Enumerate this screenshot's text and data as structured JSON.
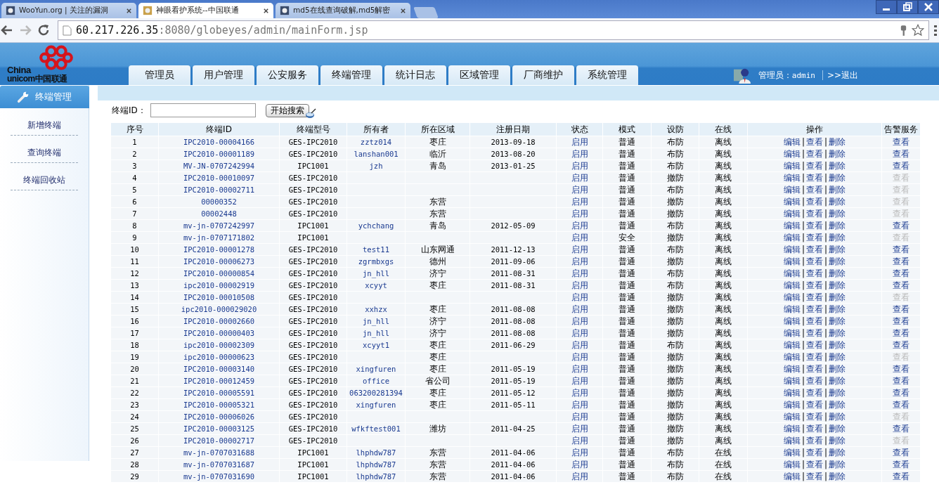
{
  "browser": {
    "tabs": [
      {
        "title": "WooYun.org | 关注的漏洞",
        "selected": false
      },
      {
        "title": "神眼看护系统--中国联通",
        "selected": true
      },
      {
        "title": "md5在线查询破解,md5解密",
        "selected": false
      }
    ],
    "url": {
      "host": "60.217.226.35",
      "path": ":8080/globeyes/admin/mainForm.jsp"
    }
  },
  "header": {
    "logo_text": [
      "China",
      "unicom中国联通"
    ],
    "nav": [
      "管理员",
      "用户管理",
      "公安服务",
      "终端管理",
      "统计日志",
      "区域管理",
      "厂商维护",
      "系统管理"
    ],
    "user_label": "管理员：",
    "user_name": "admin",
    "logout": ">>退出"
  },
  "sidebar": {
    "title": "终端管理",
    "items": [
      "新增终端",
      "查询终端",
      "终端回收站"
    ]
  },
  "search": {
    "label": "终端ID：",
    "button": "开始搜索"
  },
  "table": {
    "columns": [
      "序号",
      "终端ID",
      "终端型号",
      "所有者",
      "所在区域",
      "注册日期",
      "状态",
      "模式",
      "设防",
      "在线",
      "操作",
      "告警服务"
    ],
    "rows": [
      {
        "n": "1",
        "id": "IPC2010-00004166",
        "model": "GES-IPC2010",
        "owner": "zztz014",
        "region": "枣庄",
        "date": "2013-09-18",
        "status": "启用",
        "mode": "普通",
        "defense": "布防",
        "online": "离线",
        "actions": [
          "编辑",
          "|",
          "查看",
          "|",
          "删除"
        ],
        "alarm": "查看",
        "alarm_enabled": true
      },
      {
        "n": "2",
        "id": "IPC2010-00001189",
        "model": "GES-IPC2010",
        "owner": "lanshan001",
        "region": "临沂",
        "date": "2013-08-20",
        "status": "启用",
        "mode": "普通",
        "defense": "布防",
        "online": "离线",
        "actions": [
          "编辑",
          "|",
          "查看",
          "|",
          "删除"
        ],
        "alarm": "查看",
        "alarm_enabled": true
      },
      {
        "n": "3",
        "id": "MV-JN-0707242994",
        "model": "IPC1001",
        "owner": "jzh",
        "region": "青岛",
        "date": "2013-01-25",
        "status": "启用",
        "mode": "普通",
        "defense": "布防",
        "online": "离线",
        "actions": [
          "编辑",
          "|",
          "查看",
          "|",
          "删除"
        ],
        "alarm": "查看",
        "alarm_enabled": true
      },
      {
        "n": "4",
        "id": "IPC2010-00010097",
        "model": "GES-IPC2010",
        "status": "启用",
        "mode": "普通",
        "defense": "撤防",
        "online": "离线",
        "actions": [
          "编辑",
          "|",
          "查看",
          "|",
          "删除"
        ],
        "alarm": "查看",
        "alarm_enabled": false
      },
      {
        "n": "5",
        "id": "IPC2010-00002711",
        "model": "GES-IPC2010",
        "status": "启用",
        "mode": "普通",
        "defense": "布防",
        "online": "离线",
        "actions": [
          "编辑",
          "|",
          "查看",
          "|",
          "删除"
        ],
        "alarm": "查看",
        "alarm_enabled": false
      },
      {
        "n": "6",
        "id": "00000352",
        "model": "GES-IPC2010",
        "region": "东营",
        "status": "启用",
        "mode": "普通",
        "defense": "撤防",
        "online": "离线",
        "actions": [
          "编辑",
          "|",
          "查看",
          "|",
          "删除"
        ],
        "alarm": "查看",
        "alarm_enabled": false
      },
      {
        "n": "7",
        "id": "00002448",
        "model": "GES-IPC2010",
        "region": "东营",
        "status": "启用",
        "mode": "普通",
        "defense": "撤防",
        "online": "离线",
        "actions": [
          "编辑",
          "|",
          "查看",
          "|",
          "删除"
        ],
        "alarm": "查看",
        "alarm_enabled": false
      },
      {
        "n": "8",
        "id": "mv-jn-0707242997",
        "model": "IPC1001",
        "owner": "ychchang",
        "region": "青岛",
        "date": "2012-05-09",
        "status": "启用",
        "mode": "普通",
        "defense": "布防",
        "online": "离线",
        "actions": [
          "编辑",
          "|",
          "查看",
          "|",
          "删除"
        ],
        "alarm": "查看",
        "alarm_enabled": true
      },
      {
        "n": "9",
        "id": "mv-jn-0707171802",
        "model": "IPC1001",
        "status": "启用",
        "mode": "安全",
        "defense": "撤防",
        "online": "离线",
        "actions": [
          "编辑",
          "|",
          "查看",
          "|",
          "删除"
        ],
        "alarm": "查看",
        "alarm_enabled": false
      },
      {
        "n": "10",
        "id": "IPC2010-00001278",
        "model": "GES-IPC2010",
        "owner": "test11",
        "region": "山东网通",
        "date": "2011-12-13",
        "status": "启用",
        "mode": "普通",
        "defense": "布防",
        "online": "离线",
        "actions": [
          "编辑",
          "|",
          "查看",
          "|",
          "删除"
        ],
        "alarm": "查看",
        "alarm_enabled": true
      },
      {
        "n": "11",
        "id": "IPC2010-00006273",
        "model": "GES-IPC2010",
        "owner": "zgrmbxgs",
        "region": "德州",
        "date": "2011-09-06",
        "status": "启用",
        "mode": "普通",
        "defense": "撤防",
        "online": "离线",
        "actions": [
          "编辑",
          "|",
          "查看",
          "|",
          "删除"
        ],
        "alarm": "查看",
        "alarm_enabled": true
      },
      {
        "n": "12",
        "id": "IPC2010-00000854",
        "model": "GES-IPC2010",
        "owner": "jn_hll",
        "region": "济宁",
        "date": "2011-08-31",
        "status": "启用",
        "mode": "普通",
        "defense": "布防",
        "online": "离线",
        "actions": [
          "编辑",
          "|",
          "查看",
          "|",
          "删除"
        ],
        "alarm": "查看",
        "alarm_enabled": true
      },
      {
        "n": "13",
        "id": "ipc2010-00002919",
        "model": "GES-IPC2010",
        "owner": "xcyyt",
        "region": "枣庄",
        "date": "2011-08-31",
        "status": "启用",
        "mode": "普通",
        "defense": "布防",
        "online": "离线",
        "actions": [
          "编辑",
          "|",
          "查看",
          "|",
          "删除"
        ],
        "alarm": "查看",
        "alarm_enabled": true
      },
      {
        "n": "14",
        "id": "IPC2010-00010508",
        "model": "GES-IPC2010",
        "status": "启用",
        "mode": "普通",
        "defense": "撤防",
        "online": "离线",
        "actions": [
          "编辑",
          "|",
          "查看",
          "|",
          "删除"
        ],
        "alarm": "查看",
        "alarm_enabled": false
      },
      {
        "n": "15",
        "id": "ipc2010-000029020",
        "model": "GES-IPC2010",
        "owner": "xxhzx",
        "region": "枣庄",
        "date": "2011-08-08",
        "status": "启用",
        "mode": "普通",
        "defense": "撤防",
        "online": "离线",
        "actions": [
          "编辑",
          "|",
          "查看",
          "|",
          "删除"
        ],
        "alarm": "查看",
        "alarm_enabled": true
      },
      {
        "n": "16",
        "id": "IPC2010-00002660",
        "model": "GES-IPC2010",
        "owner": "jn_hll",
        "region": "济宁",
        "date": "2011-08-08",
        "status": "启用",
        "mode": "普通",
        "defense": "撤防",
        "online": "离线",
        "actions": [
          "编辑",
          "|",
          "查看",
          "|",
          "删除"
        ],
        "alarm": "查看",
        "alarm_enabled": true
      },
      {
        "n": "17",
        "id": "IPC2010-00000403",
        "model": "GES-IPC2010",
        "owner": "jn_hll",
        "region": "济宁",
        "date": "2011-08-08",
        "status": "启用",
        "mode": "普通",
        "defense": "撤防",
        "online": "离线",
        "actions": [
          "编辑",
          "|",
          "查看",
          "|",
          "删除"
        ],
        "alarm": "查看",
        "alarm_enabled": true
      },
      {
        "n": "18",
        "id": "ipc2010-00002309",
        "model": "GES-IPC2010",
        "owner": "xcyyt1",
        "region": "枣庄",
        "date": "2011-06-29",
        "status": "启用",
        "mode": "普通",
        "defense": "布防",
        "online": "离线",
        "actions": [
          "编辑",
          "|",
          "查看",
          "|",
          "删除"
        ],
        "alarm": "查看",
        "alarm_enabled": true
      },
      {
        "n": "19",
        "id": "ipc2010-00000623",
        "model": "GES-IPC2010",
        "region": "枣庄",
        "status": "启用",
        "mode": "普通",
        "defense": "撤防",
        "online": "离线",
        "actions": [
          "编辑",
          "|",
          "查看",
          "|",
          "删除"
        ],
        "alarm": "查看",
        "alarm_enabled": false
      },
      {
        "n": "20",
        "id": "IPC2010-00003140",
        "model": "GES-IPC2010",
        "owner": "xingfuren",
        "region": "枣庄",
        "date": "2011-05-19",
        "status": "启用",
        "mode": "普通",
        "defense": "撤防",
        "online": "离线",
        "actions": [
          "编辑",
          "|",
          "查看",
          "|",
          "删除"
        ],
        "alarm": "查看",
        "alarm_enabled": true
      },
      {
        "n": "21",
        "id": "IPC2010-00012459",
        "model": "GES-IPC2010",
        "owner": "office",
        "region": "省公司",
        "date": "2011-05-19",
        "status": "启用",
        "mode": "普通",
        "defense": "撤防",
        "online": "离线",
        "actions": [
          "编辑",
          "|",
          "查看",
          "|",
          "删除"
        ],
        "alarm": "查看",
        "alarm_enabled": true
      },
      {
        "n": "22",
        "id": "IPC2010-00005591",
        "model": "GES-IPC2010",
        "owner": "063200281394",
        "region": "枣庄",
        "date": "2011-05-12",
        "status": "启用",
        "mode": "普通",
        "defense": "撤防",
        "online": "离线",
        "actions": [
          "编辑",
          "|",
          "查看",
          "|",
          "删除"
        ],
        "alarm": "查看",
        "alarm_enabled": true
      },
      {
        "n": "23",
        "id": "IPC2010-00005321",
        "model": "GES-IPC2010",
        "owner": "xingfuren",
        "region": "枣庄",
        "date": "2011-05-11",
        "status": "启用",
        "mode": "普通",
        "defense": "撤防",
        "online": "离线",
        "actions": [
          "编辑",
          "|",
          "查看",
          "|",
          "删除"
        ],
        "alarm": "查看",
        "alarm_enabled": true
      },
      {
        "n": "24",
        "id": "IPC2010-00006026",
        "model": "GES-IPC2010",
        "status": "启用",
        "mode": "普通",
        "defense": "撤防",
        "online": "离线",
        "actions": [
          "编辑",
          "|",
          "查看",
          "|",
          "删除"
        ],
        "alarm": "查看",
        "alarm_enabled": false
      },
      {
        "n": "25",
        "id": "IPC2010-00003125",
        "model": "GES-IPC2010",
        "owner": "wfkftest001",
        "region": "潍坊",
        "date": "2011-04-25",
        "status": "启用",
        "mode": "普通",
        "defense": "撤防",
        "online": "离线",
        "actions": [
          "编辑",
          "|",
          "查看",
          "|",
          "删除"
        ],
        "alarm": "查看",
        "alarm_enabled": true
      },
      {
        "n": "26",
        "id": "IPC2010-00002717",
        "model": "GES-IPC2010",
        "status": "启用",
        "mode": "普通",
        "defense": "撤防",
        "online": "离线",
        "actions": [
          "编辑",
          "|",
          "查看",
          "|",
          "删除"
        ],
        "alarm": "查看",
        "alarm_enabled": false
      },
      {
        "n": "27",
        "id": "mv-jn-0707031688",
        "model": "IPC1001",
        "owner": "lhphdw787",
        "region": "东营",
        "date": "2011-04-06",
        "status": "启用",
        "mode": "普通",
        "defense": "布防",
        "online": "在线",
        "actions": [
          "编辑",
          "|",
          "查看",
          "|",
          "删除"
        ],
        "alarm": "查看",
        "alarm_enabled": true
      },
      {
        "n": "28",
        "id": "mv-jn-0707031687",
        "model": "IPC1001",
        "owner": "lhphdw787",
        "region": "东营",
        "date": "2011-04-06",
        "status": "启用",
        "mode": "普通",
        "defense": "布防",
        "online": "在线",
        "actions": [
          "编辑",
          "|",
          "查看",
          "|",
          "删除"
        ],
        "alarm": "查看",
        "alarm_enabled": true
      },
      {
        "n": "29",
        "id": "mv-jn-0707031690",
        "model": "IPC1001",
        "owner": "lhphdw787",
        "region": "东营",
        "date": "2011-04-06",
        "status": "启用",
        "mode": "普通",
        "defense": "布防",
        "online": "在线",
        "actions": [
          "编辑",
          "|",
          "查看",
          "|",
          "删除"
        ],
        "alarm": "查看",
        "alarm_enabled": true
      }
    ]
  }
}
